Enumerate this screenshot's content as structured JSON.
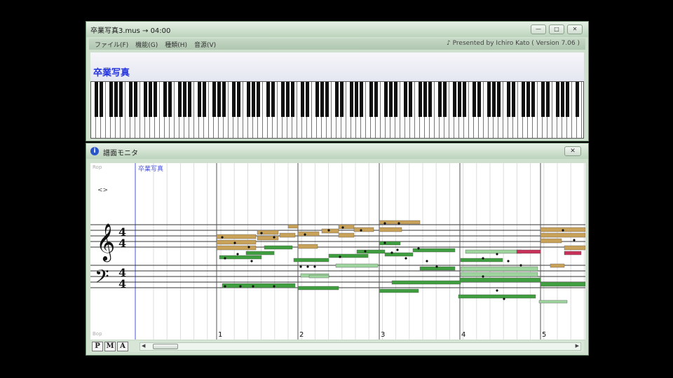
{
  "main_window": {
    "title": "卒業写真3.mus → 04:00",
    "menu": [
      "ファイル(F)",
      "機能(G)",
      "種類(H)",
      "音源(V)"
    ],
    "credit": "♪ Presented by Ichiro Kato ( Version 7.06 )",
    "song_title": "卒業写真",
    "buttons": {
      "minimize": "—",
      "maximize": "□",
      "close": "✕"
    }
  },
  "monitor": {
    "title": "譜面モニタ",
    "close": "✕",
    "track_label": "卒業写真",
    "fold_symbol": "<>",
    "top_label": "Rop",
    "bottom_label": "Bop",
    "measures": [
      "1",
      "2",
      "3",
      "4",
      "5"
    ],
    "mode_buttons": [
      "P",
      "M",
      "A"
    ]
  },
  "colors": {
    "melody": "#c9a25a",
    "accompaniment": "#3f9e3f",
    "light_green": "#9ed49e",
    "accent": "#c8325a",
    "measure_line": "#555555",
    "track_line": "#4a55dd"
  }
}
